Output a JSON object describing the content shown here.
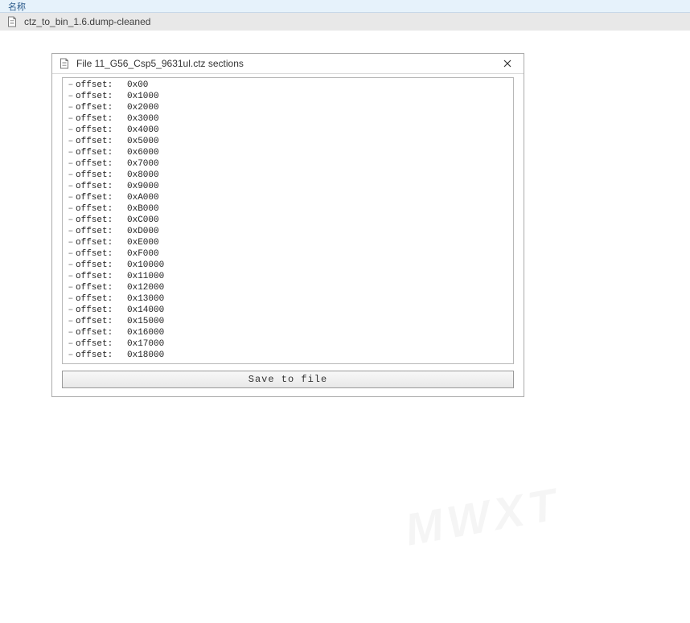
{
  "header": {
    "column_label": "名称"
  },
  "file_row": {
    "filename": "ctz_to_bin_1.6.dump-cleaned"
  },
  "dialog": {
    "title": "File 11_G56_Csp5_9631ul.ctz sections",
    "offset_label": "offset:",
    "offsets": [
      "0x00",
      "0x1000",
      "0x2000",
      "0x3000",
      "0x4000",
      "0x5000",
      "0x6000",
      "0x7000",
      "0x8000",
      "0x9000",
      "0xA000",
      "0xB000",
      "0xC000",
      "0xD000",
      "0xE000",
      "0xF000",
      "0x10000",
      "0x11000",
      "0x12000",
      "0x13000",
      "0x14000",
      "0x15000",
      "0x16000",
      "0x17000",
      "0x18000"
    ],
    "save_button": "Save to file"
  },
  "watermark": "MWXT"
}
